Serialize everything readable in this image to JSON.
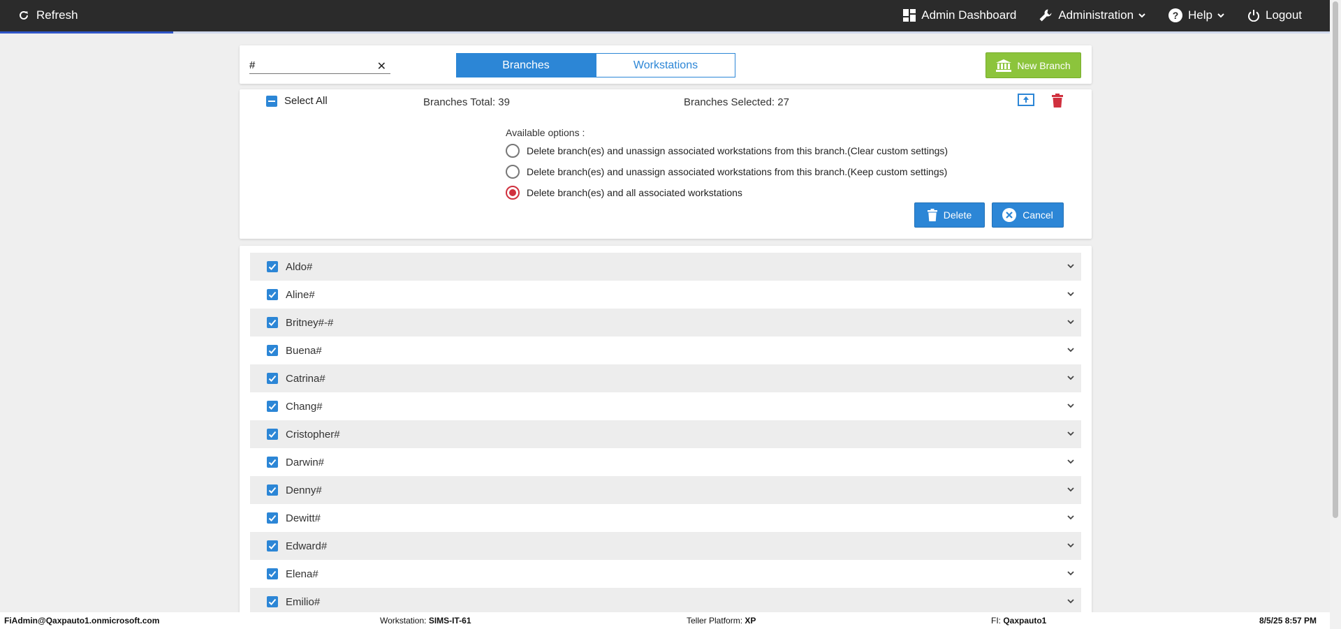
{
  "topbar": {
    "refresh_label": "Refresh",
    "admin_dashboard_label": "Admin Dashboard",
    "administration_label": "Administration",
    "help_label": "Help",
    "logout_label": "Logout",
    "progress_fraction": 0.13
  },
  "search": {
    "value": "#"
  },
  "tabs": [
    {
      "label": "Branches",
      "active": true
    },
    {
      "label": "Workstations",
      "active": false
    }
  ],
  "new_branch_label": "New Branch",
  "selection": {
    "select_all_label": "Select All",
    "total_label": "Branches Total: 39",
    "selected_label": "Branches Selected: 27"
  },
  "options": {
    "heading": "Available options :",
    "items": [
      {
        "label": "Delete branch(es) and unassign associated workstations from this branch.(Clear custom settings)",
        "selected": false
      },
      {
        "label": "Delete branch(es) and unassign associated workstations from this branch.(Keep custom settings)",
        "selected": false
      },
      {
        "label": "Delete branch(es) and all associated workstations",
        "selected": true
      }
    ],
    "delete_label": "Delete",
    "cancel_label": "Cancel"
  },
  "branches": [
    {
      "name": "Aldo#",
      "checked": true
    },
    {
      "name": "Aline#",
      "checked": true
    },
    {
      "name": "Britney#-#",
      "checked": true
    },
    {
      "name": "Buena#",
      "checked": true
    },
    {
      "name": "Catrina#",
      "checked": true
    },
    {
      "name": "Chang#",
      "checked": true
    },
    {
      "name": "Cristopher#",
      "checked": true
    },
    {
      "name": "Darwin#",
      "checked": true
    },
    {
      "name": "Denny#",
      "checked": true
    },
    {
      "name": "Dewitt#",
      "checked": true
    },
    {
      "name": "Edward#",
      "checked": true
    },
    {
      "name": "Elena#",
      "checked": true
    },
    {
      "name": "Emilio#",
      "checked": true
    }
  ],
  "footer": {
    "user": "FiAdmin@Qaxpauto1.onmicrosoft.com",
    "workstation_label": "Workstation:",
    "workstation_value": "SIMS-IT-61",
    "platform_label": "Teller Platform:",
    "platform_value": "XP",
    "fi_label": "FI:",
    "fi_value": "Qaxpauto1",
    "datetime": "8/5/25 8:57 PM"
  },
  "colors": {
    "topbar": "#2b2b2b",
    "primary": "#2c86d6",
    "success": "#8cc43c",
    "danger": "#d0303e"
  }
}
